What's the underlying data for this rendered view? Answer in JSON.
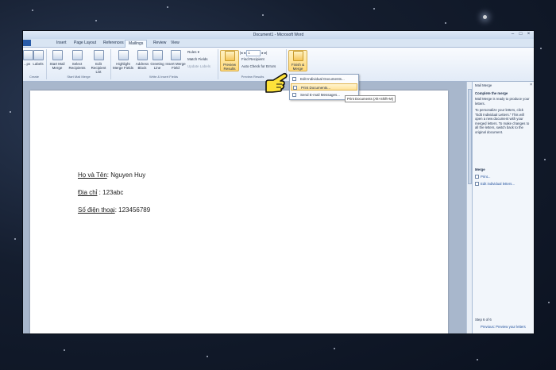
{
  "window": {
    "title": "Document1 - Microsoft Word"
  },
  "tabs": [
    "Insert",
    "Page Layout",
    "References",
    "Mailings",
    "Review",
    "View"
  ],
  "active_tab": "Mailings",
  "ribbon": {
    "create_group": {
      "labels_partial": "...ps",
      "labels": "Labels",
      "group_label": "Create"
    },
    "start_group": {
      "start_mail_merge": "Start Mail Merge",
      "select_recipients": "Select Recipients",
      "edit_recipient_list": "Edit Recipient List",
      "group_label": "Start Mail Merge"
    },
    "write_group": {
      "highlight_merge_fields": "Highlight Merge Fields",
      "address_block": "Address Block",
      "greeting_line": "Greeting Line",
      "insert_merge_field": "Insert Merge Field",
      "rules": "Rules",
      "match_fields": "Match Fields",
      "update_labels": "Update Labels",
      "group_label": "Write & Insert Fields"
    },
    "preview_group": {
      "preview_results": "Preview Results",
      "record_number": "1",
      "find_recipient": "Find Recipient",
      "auto_check": "Auto Check for Errors",
      "group_label": "Preview Results"
    },
    "finish_group": {
      "finish_merge": "Finish & Merge"
    }
  },
  "finish_menu": {
    "items": [
      "Edit Individual Documents...",
      "Print Documents...",
      "Send E-mail Messages..."
    ],
    "hovered_index": 1,
    "tooltip": "Print Documents (Alt+Shift+M)"
  },
  "document": {
    "fields": [
      {
        "label": "Họ và Tên",
        "value": ": Nguyen Huy"
      },
      {
        "label": "Địa chỉ",
        "value": " : 123abc"
      },
      {
        "label": "Số điện thoại",
        "value": ": 123456789"
      }
    ]
  },
  "task_pane": {
    "title": "Mail Merge",
    "close": "×",
    "heading": "Complete the merge",
    "intro": "Mail Merge is ready to produce your letters.",
    "instructions": "To personalize your letters, click \"Edit Individual Letters.\" This will open a new document with your merged letters. To make changes to all the letters, switch back to the original document.",
    "merge_heading": "Merge",
    "merge_links": [
      "Print...",
      "Edit individual letters..."
    ],
    "step": "Step 6 of 6",
    "previous_link": "Previous: Preview your letters"
  }
}
